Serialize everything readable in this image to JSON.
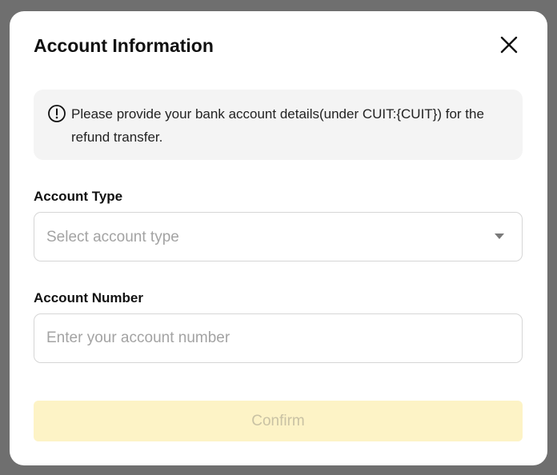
{
  "modal": {
    "title": "Account Information",
    "close_icon": "close-icon"
  },
  "notice": {
    "icon": "info-circle-icon",
    "text": "Please provide your bank account details(under CUIT:{CUIT}) for the refund transfer."
  },
  "account_type": {
    "label": "Account Type",
    "placeholder": "Select account type",
    "icon": "caret-down-icon"
  },
  "account_number": {
    "label": "Account Number",
    "placeholder": "Enter your account number",
    "value": ""
  },
  "confirm": {
    "label": "Confirm",
    "disabled": true
  },
  "colors": {
    "overlay": "#6f6f6f",
    "panel": "#ffffff",
    "notice_bg": "#f4f4f4",
    "confirm_bg": "#fdf3c6",
    "confirm_text": "#c9c2a4",
    "placeholder": "#a3a3a3"
  }
}
